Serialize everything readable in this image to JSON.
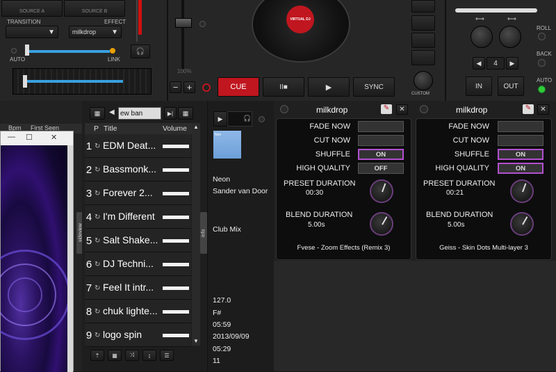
{
  "deck": {
    "source_a": "SOURCE A",
    "source_b": "SOURCE B",
    "transition_label": "TRANSITION",
    "effect_label": "EFFECT",
    "effect_value": "milkdrop",
    "auto_label": "AUTO",
    "link_label": "LINK",
    "pitch_label": "100%",
    "cue_label": "CUE",
    "pause_play_label": "II■",
    "play_label": "▶",
    "sync_label": "SYNC",
    "brand_label": "VIRTUAL DJ",
    "custom_label": "CUSTOM",
    "roll_label": "ROLL",
    "back_label": "BACK",
    "auto_right_label": "AUTO",
    "loop_value": "4",
    "in_label": "IN",
    "out_label": "OUT",
    "minus_label": "−",
    "plus_label": "+"
  },
  "browser": {
    "columns": [
      "Bpm",
      "First Seen"
    ],
    "window_minimize": "—",
    "window_maximize": "☐",
    "window_close": "✕",
    "sideview_label": "sideview",
    "info_label": "info"
  },
  "playlist": {
    "search_value": "ew ban",
    "col_p": "P",
    "col_title": "Title",
    "col_volume": "Volume",
    "rows": [
      {
        "num": "1",
        "title": "EDM Deat..."
      },
      {
        "num": "2",
        "title": "Bassmonk..."
      },
      {
        "num": "3",
        "title": "Forever   2..."
      },
      {
        "num": "4",
        "title": "I'm Different"
      },
      {
        "num": "5",
        "title": "Salt Shake..."
      },
      {
        "num": "6",
        "title": "DJ Techni..."
      },
      {
        "num": "7",
        "title": "Feel It  intr..."
      },
      {
        "num": "8",
        "title": "chuk lighte..."
      },
      {
        "num": "9",
        "title": "logo spin"
      }
    ]
  },
  "trackinfo": {
    "cover_text": "Neo",
    "title": "Neon",
    "artist": "Sander van Door",
    "remix": "Club Mix",
    "bpm": "127.0",
    "key": "F#",
    "length": "05:59",
    "date": "2013/09/09",
    "time2": "05:29",
    "count": "11"
  },
  "fx_left": {
    "name": "milkdrop",
    "fade_now": "FADE NOW",
    "cut_now": "CUT NOW",
    "shuffle": "SHUFFLE",
    "shuffle_state": "ON",
    "high_quality": "HIGH QUALITY",
    "high_quality_state": "OFF",
    "preset_duration": "PRESET DURATION",
    "preset_value": "00:30",
    "blend_duration": "BLEND DURATION",
    "blend_value": "5.00s",
    "preset_name": "Fvese - Zoom Effects (Remix 3)"
  },
  "fx_right": {
    "name": "milkdrop",
    "fade_now": "FADE NOW",
    "cut_now": "CUT NOW",
    "shuffle": "SHUFFLE",
    "shuffle_state": "ON",
    "high_quality": "HIGH QUALITY",
    "high_quality_state": "ON",
    "preset_duration": "PRESET DURATION",
    "preset_value": "00:21",
    "blend_duration": "BLEND DURATION",
    "blend_value": "5.00s",
    "preset_name": "Geiss - Skin Dots Multi-layer 3"
  },
  "colors": {
    "cue_red": "#c0161f",
    "accent_purple": "#b24fd0",
    "slider_blue": "#3aa0e0"
  }
}
